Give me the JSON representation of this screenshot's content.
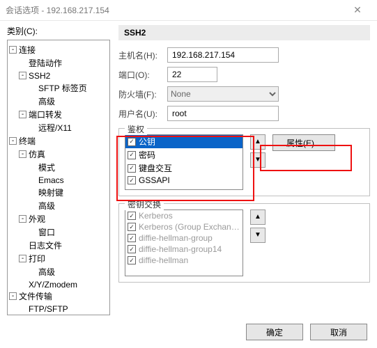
{
  "window": {
    "title": "会话选项 - 192.168.217.154",
    "close": "✕"
  },
  "category_label": "类别(C):",
  "tree": {
    "n0": "连接",
    "n0_0": "登陆动作",
    "n0_1": "SSH2",
    "n0_1_0": "SFTP 标签页",
    "n0_1_1": "高级",
    "n0_2": "端口转发",
    "n0_2_0": "远程/X11",
    "n1": "终端",
    "n1_0": "仿真",
    "n1_0_0": "模式",
    "n1_0_1": "Emacs",
    "n1_0_2": "映射键",
    "n1_0_3": "高级",
    "n1_1": "外观",
    "n1_1_0": "窗口",
    "n1_2": "日志文件",
    "n1_3": "打印",
    "n1_3_0": "高级",
    "n1_4": "X/Y/Zmodem",
    "n2": "文件传输",
    "n2_0": "FTP/SFTP"
  },
  "panel_title": "SSH2",
  "form": {
    "host_label": "主机名(H):",
    "host": "192.168.217.154",
    "port_label": "端口(O):",
    "port": "22",
    "fw_label": "防火墙(F):",
    "fw": "None",
    "user_label": "用户名(U):",
    "user": "root"
  },
  "auth": {
    "legend": "鉴权",
    "items": [
      "公钥",
      "密码",
      "键盘交互",
      "GSSAPI"
    ],
    "prop_btn": "属性(E)...",
    "up": "▲",
    "down": "▼"
  },
  "kex": {
    "legend": "密钥交换",
    "items": [
      "Kerberos",
      "Kerberos (Group Exchange)",
      "diffie-hellman-group",
      "diffie-hellman-group14",
      "diffie-hellman"
    ],
    "up": "▲",
    "down": "▼"
  },
  "footer": {
    "ok": "确定",
    "cancel": "取消"
  }
}
